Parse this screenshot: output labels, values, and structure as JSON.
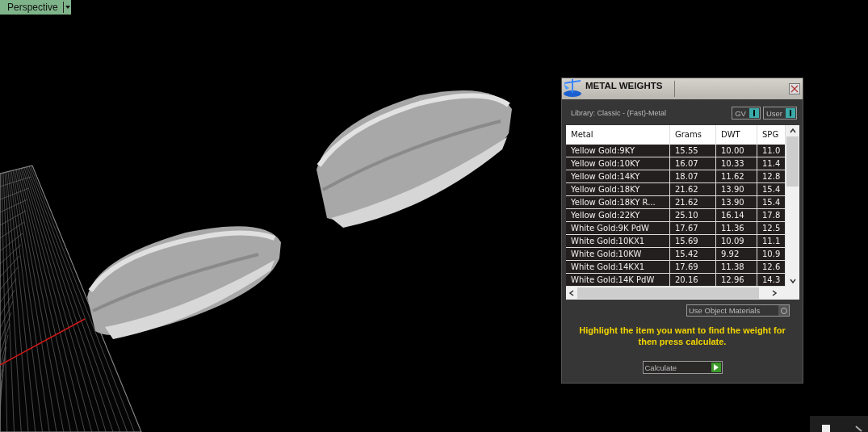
{
  "viewport": {
    "label": "Perspective"
  },
  "panel": {
    "title": "METAL WEIGHTS",
    "library": "Library: Classic - (Fast)-Metal",
    "toggles": [
      {
        "label": "GV",
        "on": true
      },
      {
        "label": "User",
        "on": true
      }
    ],
    "columns": [
      "Metal",
      "Grams",
      "DWT",
      "SPG"
    ],
    "rows": [
      {
        "cells": [
          "Yellow Gold:9KY",
          "15.55",
          "10.00",
          "11.0"
        ]
      },
      {
        "cells": [
          "Yellow Gold:10KY",
          "16.07",
          "10.33",
          "11.4"
        ]
      },
      {
        "cells": [
          "Yellow Gold:14KY",
          "18.07",
          "11.62",
          "12.8"
        ]
      },
      {
        "cells": [
          "Yellow Gold:18KY",
          "21.62",
          "13.90",
          "15.4"
        ]
      },
      {
        "cells": [
          "Yellow Gold:18KY R...",
          "21.62",
          "13.90",
          "15.4"
        ]
      },
      {
        "cells": [
          "Yellow Gold:22KY",
          "25.10",
          "16.14",
          "17.8"
        ]
      },
      {
        "cells": [
          "White Gold:9K PdW",
          "17.67",
          "11.36",
          "12.5"
        ]
      },
      {
        "cells": [
          "White Gold:10KX1",
          "15.69",
          "10.09",
          "11.1"
        ]
      },
      {
        "cells": [
          "White Gold:10KW",
          "15.42",
          "9.92",
          "10.9"
        ]
      },
      {
        "cells": [
          "White Gold:14KX1",
          "17.69",
          "11.38",
          "12.6"
        ]
      },
      {
        "cells": [
          "White Gold:14K PdW",
          "20.16",
          "12.96",
          "14.3"
        ]
      }
    ],
    "use_object_materials": {
      "label": "Use Object Materials",
      "on": false
    },
    "hint": "Highlight the item you want to find the weight for then press calculate.",
    "calculate": "Calculate"
  }
}
